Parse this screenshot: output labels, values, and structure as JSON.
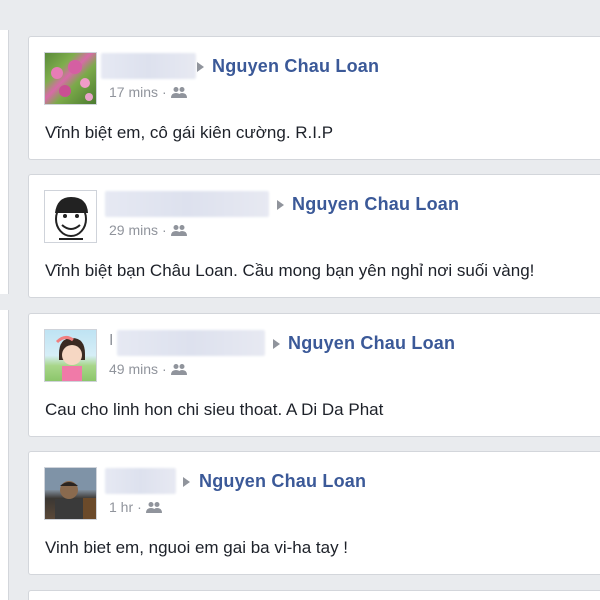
{
  "posts": [
    {
      "avatar": "flowers-photo-avatar",
      "target": "Nguyen Chau Loan",
      "time": "17 mins",
      "separator": "·",
      "audience_icon": "friends-icon",
      "message": "Vĩnh biệt em, cô gái kiên cường. R.I.P"
    },
    {
      "avatar": "cartoon-face-avatar",
      "target": "Nguyen Chau Loan",
      "time": "29 mins",
      "separator": "·",
      "audience_icon": "friends-icon",
      "message": "Vĩnh biệt bạn Châu Loan. Cầu mong bạn yên nghỉ nơi suối vàng!"
    },
    {
      "avatar": "girl-photo-avatar",
      "name_fragment": "I",
      "target": "Nguyen Chau Loan",
      "time": "49 mins",
      "separator": "·",
      "audience_icon": "friends-icon",
      "message": "Cau cho linh hon chi sieu thoat. A Di Da Phat"
    },
    {
      "avatar": "man-photo-avatar",
      "target": "Nguyen Chau Loan",
      "time": "1 hr",
      "separator": "·",
      "audience_icon": "friends-icon",
      "message": "Vinh biet em, nguoi em gai ba vi-ha tay !"
    }
  ],
  "colors": {
    "link": "#3b5998",
    "meta": "#90949c",
    "text": "#1d2129",
    "background": "#e9ebee"
  }
}
